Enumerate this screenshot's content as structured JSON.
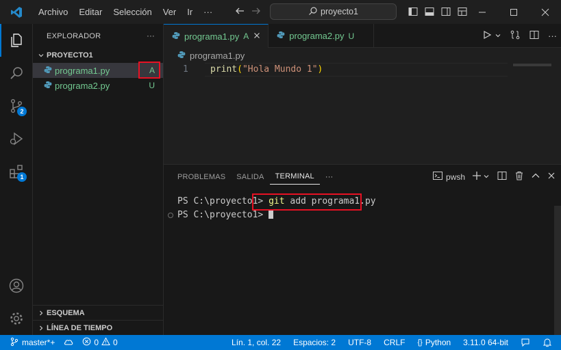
{
  "titlebar": {
    "menus": [
      "Archivo",
      "Editar",
      "Selección",
      "Ver",
      "Ir"
    ],
    "more": "···",
    "search": "proyecto1"
  },
  "activity": {
    "scm_badge": "2",
    "extensions_badge": "1"
  },
  "sidebar": {
    "title": "EXPLORADOR",
    "more": "···",
    "project": "PROYECTO1",
    "files": [
      {
        "name": "programa1.py",
        "status": "A"
      },
      {
        "name": "programa2.py",
        "status": "U"
      }
    ],
    "outline": "ESQUEMA",
    "timeline": "LÍNEA DE TIEMPO"
  },
  "editor": {
    "tabs": [
      {
        "label": "programa1.py",
        "status": "A"
      },
      {
        "label": "programa2.py",
        "status": "U"
      }
    ],
    "breadcrumb": "programa1.py",
    "line_number": "1",
    "code": {
      "fn": "print",
      "open": "(",
      "str": "\"Hola Mundo 1\"",
      "close": ")"
    }
  },
  "panel": {
    "tabs": [
      "PROBLEMAS",
      "SALIDA",
      "TERMINAL"
    ],
    "more": "···",
    "terminal_name": "pwsh",
    "lines": [
      {
        "prompt": "PS C:\\proyecto1> ",
        "cmd_keyword": "git",
        "cmd_rest": " add programa1.py"
      },
      {
        "prompt": "PS C:\\proyecto1> "
      }
    ]
  },
  "statusbar": {
    "branch": "master*+",
    "errors": "0",
    "warnings": "0",
    "position": "Lín. 1, col. 22",
    "spaces": "Espacios: 2",
    "encoding": "UTF-8",
    "eol": "CRLF",
    "language": "Python",
    "interpreter": "3.11.0 64-bit"
  },
  "colors": {
    "accent": "#0078d4",
    "git_added": "#73c991",
    "highlight_box": "#e81123"
  }
}
